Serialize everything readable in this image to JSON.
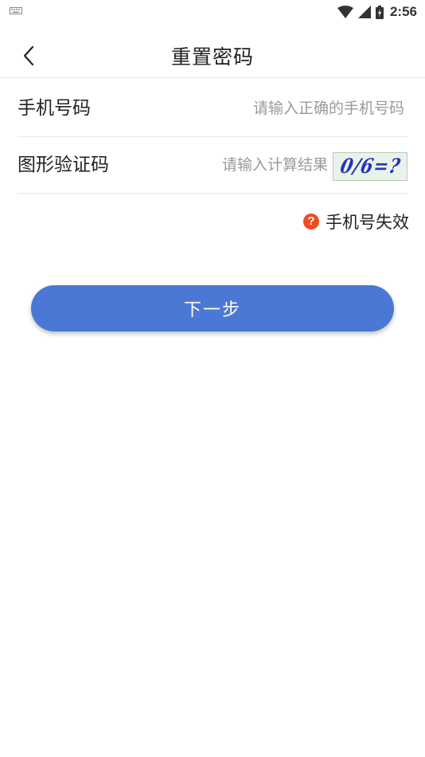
{
  "status_bar": {
    "time": "2:56",
    "icons": [
      "keyboard-icon",
      "wifi-icon",
      "cell-signal-icon",
      "battery-icon"
    ]
  },
  "header": {
    "title": "重置密码",
    "back_icon": "chevron-left-icon"
  },
  "form": {
    "phone": {
      "label": "手机号码",
      "placeholder": "请输入正确的手机号码",
      "value": ""
    },
    "captcha": {
      "label": "图形验证码",
      "placeholder": "请输入计算结果",
      "value": "",
      "image_text": "0/6=?"
    }
  },
  "error": {
    "icon": "question-circle-icon",
    "text": "手机号失效",
    "color": "#f04a20"
  },
  "actions": {
    "next_label": "下一步",
    "accent_color": "#4a78d4"
  }
}
